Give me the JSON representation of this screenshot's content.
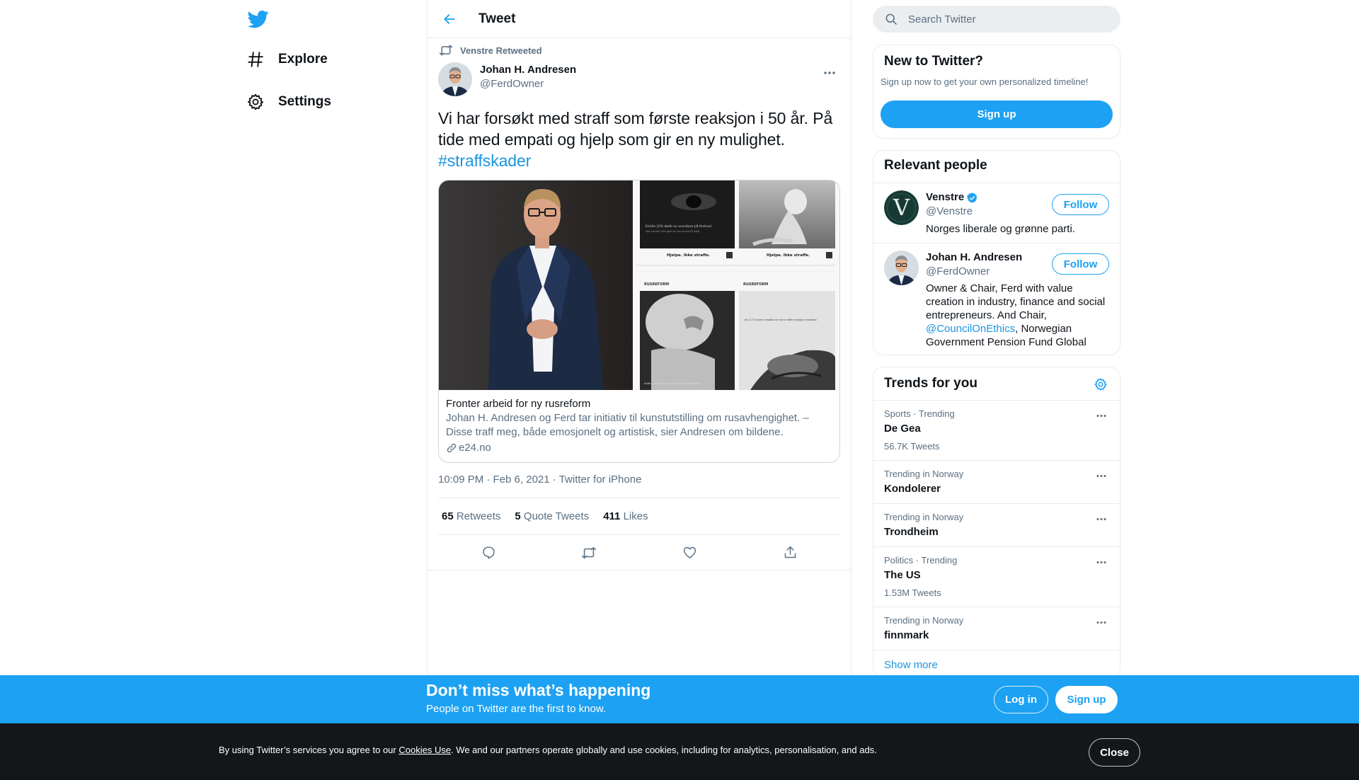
{
  "colors": {
    "brand": "#1da1f2",
    "link": "#1b95e0",
    "text": "#0f1419",
    "secondary": "#5b7083",
    "border": "#e6ecf0",
    "cookie_bg": "#14171a"
  },
  "nav": {
    "logo_icon": "twitter-bird-icon",
    "items": [
      {
        "label": "Explore",
        "icon": "hashtag-icon"
      },
      {
        "label": "Settings",
        "icon": "gear-icon"
      }
    ]
  },
  "header": {
    "back_icon": "arrow-left-icon",
    "title": "Tweet"
  },
  "tweet": {
    "retweeted_by": "Venstre Retweeted",
    "author_name": "Johan H. Andresen",
    "author_handle": "@FerdOwner",
    "text": "Vi har forsøkt med straff som første reaksjon i 50 år. På tide med empati og hjelp som gir en ny mulighet.",
    "hashtag": "#straffskader",
    "card": {
      "images": {
        "left": "portrait of man in suit",
        "right_top_caption_1": "Emilie (19) døde av overdose på festival.",
        "right_top_caption_2": "Nye verdier ville gjort at hun kunne få hjelp.",
        "poster_brand_1": "Hjelpe. Ikke straffe.",
        "poster_brand_2": "Hjelpe. Ikke straffe.",
        "logo_1": "RUSREFORM",
        "logo_2": "RUSREFORM",
        "bottom_caption_1": "Sofie (20) turte ikke ornmelde voldtekten.",
        "bottom_caption_2": "Jon (17) brukte narkotika for hans måtte avlegge urinprøver."
      },
      "title": "Fronter arbeid for ny rusreform",
      "description": "Johan H. Andresen og Ferd tar initiativ til kunstutstilling om rusavhengighet. – Disse traff meg, både emosjonelt og artistisk, sier Andresen om bildene.",
      "domain": "e24.no"
    },
    "time": "10:09 PM · Feb 6, 2021",
    "source": "Twitter for iPhone",
    "retweets": "65",
    "retweets_label": "Retweets",
    "quotes": "5",
    "quotes_label": "Quote Tweets",
    "likes": "411",
    "likes_label": "Likes"
  },
  "search": {
    "placeholder": "Search Twitter"
  },
  "new_to_twitter": {
    "title": "New to Twitter?",
    "subtitle": "Sign up now to get your own personalized timeline!",
    "signup": "Sign up"
  },
  "relevant_people": {
    "title": "Relevant people",
    "people": [
      {
        "name": "Venstre",
        "handle": "@Venstre",
        "verified": true,
        "follow": "Follow",
        "bio": "Norges liberale og grønne parti.",
        "avatar_letter": "V"
      },
      {
        "name": "Johan H. Andresen",
        "handle": "@FerdOwner",
        "verified": false,
        "follow": "Follow",
        "bio_1": "Owner & Chair, Ferd with value creation in industry, finance and social entrepreneurs. And Chair, ",
        "bio_mention": "@CouncilOnEthics",
        "bio_2": ", Norwegian Government Pension Fund Global"
      }
    ]
  },
  "trends": {
    "title": "Trends for you",
    "items": [
      {
        "context": "Sports · Trending",
        "name": "De Gea",
        "count": "56.7K Tweets"
      },
      {
        "context": "Trending in Norway",
        "name": "Kondolerer"
      },
      {
        "context": "Trending in Norway",
        "name": "Trondheim"
      },
      {
        "context": "Politics · Trending",
        "name": "The US",
        "count": "1.53M Tweets"
      },
      {
        "context": "Trending in Norway",
        "name": "finnmark"
      }
    ],
    "show_more": "Show more"
  },
  "banner": {
    "title": "Don’t miss what’s happening",
    "subtitle": "People on Twitter are the first to know.",
    "login": "Log in",
    "signup": "Sign up"
  },
  "cookie": {
    "text_before": "By using Twitter’s services you agree to our ",
    "link": "Cookies Use",
    "text_after": ". We and our partners operate globally and use cookies, including for analytics, personalisation, and ads.",
    "close": "Close"
  }
}
